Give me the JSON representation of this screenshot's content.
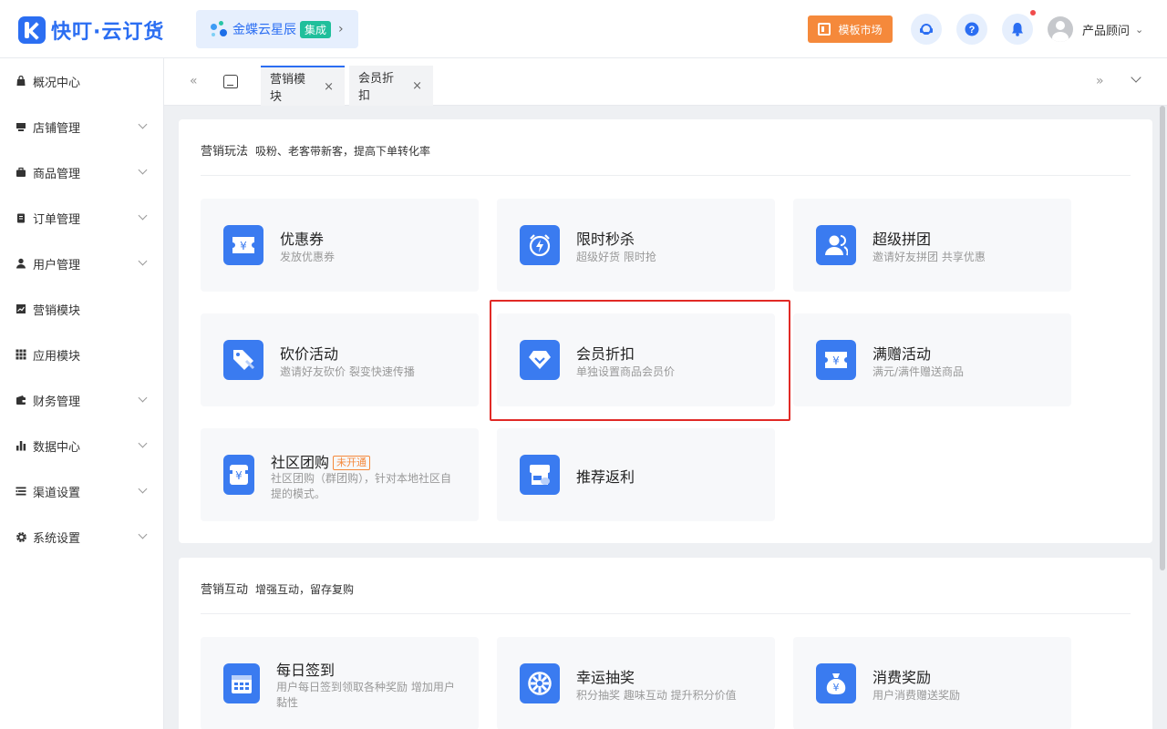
{
  "header": {
    "logo_text": "快叮·云订货",
    "brand_name": "金蝶云星辰",
    "brand_badge": "集成",
    "market_label": "模板市场",
    "user_name": "产品顾问"
  },
  "sidebar": {
    "items": [
      {
        "label": "概况中心",
        "icon": "bag-icon",
        "expandable": false
      },
      {
        "label": "店铺管理",
        "icon": "store-icon",
        "expandable": true
      },
      {
        "label": "商品管理",
        "icon": "briefcase-icon",
        "expandable": true
      },
      {
        "label": "订单管理",
        "icon": "clipboard-icon",
        "expandable": true
      },
      {
        "label": "用户管理",
        "icon": "user-icon",
        "expandable": true
      },
      {
        "label": "营销模块",
        "icon": "chart-icon",
        "expandable": false
      },
      {
        "label": "应用模块",
        "icon": "apps-icon",
        "expandable": false
      },
      {
        "label": "财务管理",
        "icon": "wallet-icon",
        "expandable": true
      },
      {
        "label": "数据中心",
        "icon": "bar-chart-icon",
        "expandable": true
      },
      {
        "label": "渠道设置",
        "icon": "list-icon",
        "expandable": true
      },
      {
        "label": "系统设置",
        "icon": "gear-icon",
        "expandable": true
      }
    ]
  },
  "tabs": [
    {
      "label": "营销模块",
      "active": true
    },
    {
      "label": "会员折扣",
      "active": false
    }
  ],
  "sections": [
    {
      "title": "营销玩法",
      "subtitle": "吸粉、老客带新客，提高下单转化率",
      "cards": [
        {
          "title": "优惠券",
          "desc": "发放优惠券",
          "icon": "coupon-icon"
        },
        {
          "title": "限时秒杀",
          "desc": "超级好货 限时抢",
          "icon": "alarm-icon"
        },
        {
          "title": "超级拼团",
          "desc": "邀请好友拼团 共享优惠",
          "icon": "group-icon"
        },
        {
          "title": "砍价活动",
          "desc": "邀请好友砍价 裂变快速传播",
          "icon": "price-tag-icon"
        },
        {
          "title": "会员折扣",
          "desc": "单独设置商品会员价",
          "icon": "diamond-icon"
        },
        {
          "title": "满赠活动",
          "desc": "满元/满件赠送商品",
          "icon": "gift-coupon-icon"
        },
        {
          "title": "社区团购",
          "badge": "未开通",
          "desc": "社区团购（群团购），针对本地社区自提的模式。",
          "icon": "community-icon"
        },
        {
          "title": "推荐返利",
          "desc": "",
          "icon": "rebate-icon"
        }
      ]
    },
    {
      "title": "营销互动",
      "subtitle": "增强互动，留存复购",
      "cards": [
        {
          "title": "每日签到",
          "desc": "用户每日签到领取各种奖励 增加用户黏性",
          "icon": "calendar-icon"
        },
        {
          "title": "幸运抽奖",
          "desc": "积分抽奖 趣味互动 提升积分价值",
          "icon": "wheel-icon"
        },
        {
          "title": "消费奖励",
          "desc": "用户消费赠送奖励",
          "icon": "money-bag-icon"
        }
      ]
    }
  ],
  "colors": {
    "accent": "#2b6ef2",
    "orange": "#f5893b",
    "highlight": "#e12a26"
  }
}
